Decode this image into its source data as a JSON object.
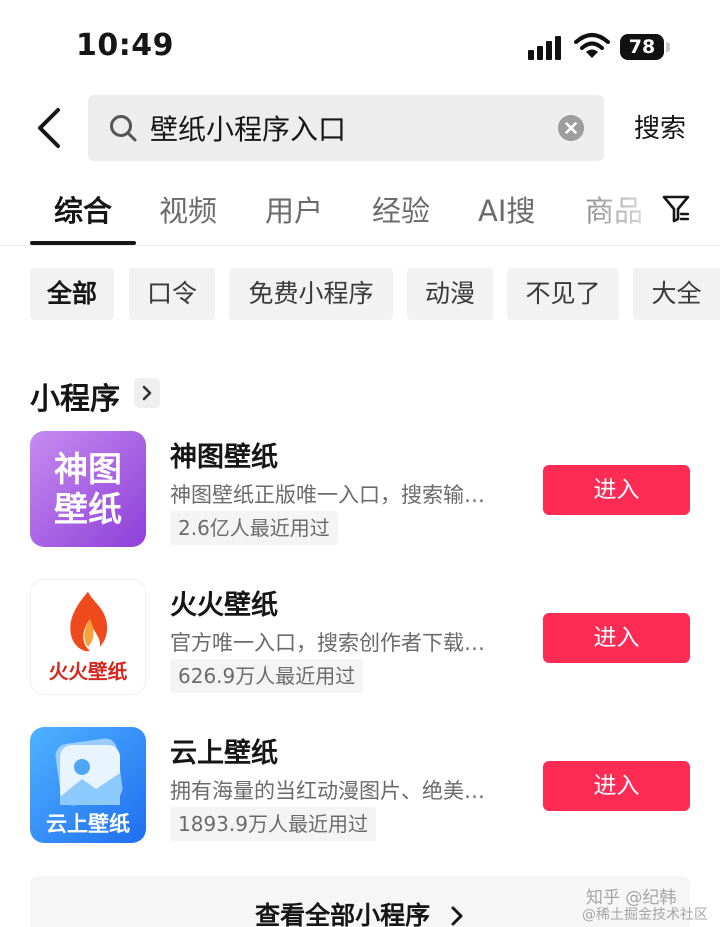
{
  "status_bar": {
    "time": "10:49",
    "battery": "78",
    "signal_icon": "signal-icon",
    "wifi_icon": "wifi-icon"
  },
  "search": {
    "query": "壁纸小程序入口",
    "submit_label": "搜索"
  },
  "tabs": [
    {
      "label": "综合",
      "active": true
    },
    {
      "label": "视频"
    },
    {
      "label": "用户"
    },
    {
      "label": "经验"
    },
    {
      "label": "AI搜"
    },
    {
      "label": "商品"
    }
  ],
  "chips": [
    {
      "label": "全部",
      "active": true
    },
    {
      "label": "口令"
    },
    {
      "label": "免费小程序"
    },
    {
      "label": "动漫"
    },
    {
      "label": "不见了"
    },
    {
      "label": "大全"
    }
  ],
  "section": {
    "title": "小程序"
  },
  "mini_programs": [
    {
      "name": "神图壁纸",
      "icon_text": [
        "神图",
        "壁纸"
      ],
      "description": "神图壁纸正版唯一入口，搜索输…",
      "usage": "2.6亿人最近用过",
      "button": "进入"
    },
    {
      "name": "火火壁纸",
      "icon_text": [
        "火火壁纸"
      ],
      "description": "官方唯一入口，搜索创作者下载…",
      "usage": "626.9万人最近用过",
      "button": "进入"
    },
    {
      "name": "云上壁纸",
      "icon_text": [
        "云上壁纸"
      ],
      "description": "拥有海量的当红动漫图片、绝美…",
      "usage": "1893.9万人最近用过",
      "button": "进入"
    }
  ],
  "view_all": {
    "label": "查看全部小程序"
  },
  "watermarks": [
    "知乎 @纪韩",
    "@稀土掘金技术社区"
  ],
  "colors": {
    "accent": "#fe2c55",
    "chip_bg": "#f2f2f2",
    "search_bg": "#ededed"
  }
}
